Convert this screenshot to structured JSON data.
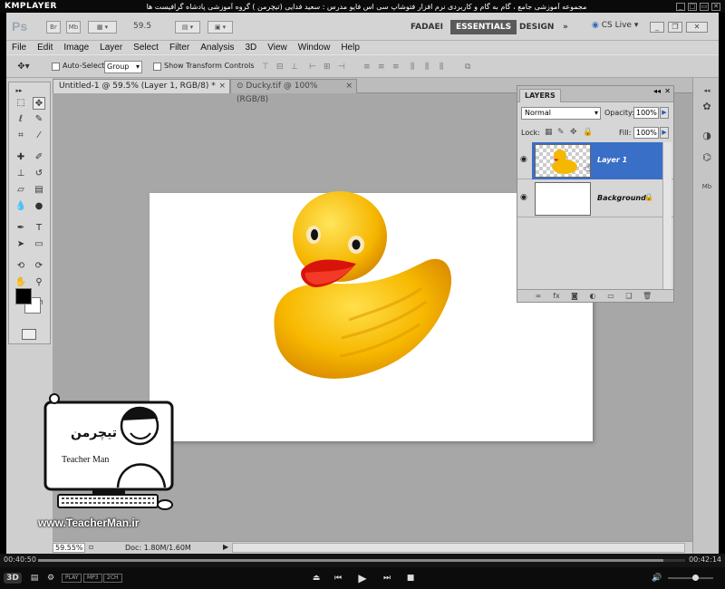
{
  "player": {
    "logo": "KMPLAYER",
    "title": "مجموعه آموزشی جامع ، گام به گام و کاربردی نرم افزار فتوشاپ سی اس فایو  مدرس : سعید فدایی (تیچرمن ) گروه آموزشی پادشاه گرافیست ها",
    "time_elapsed": "00:40:50",
    "time_total": "00:42:14",
    "progress": 0.967,
    "badges": [
      "PLAY",
      "MP3",
      "2CH"
    ],
    "mode_label": "3D",
    "volume": 0.6,
    "window_buttons": [
      "_",
      "□",
      "▭",
      "✕"
    ]
  },
  "ps": {
    "logo": "Ps",
    "appbar": {
      "br_label": "Br",
      "mb_label": "Mb",
      "zoom": "59.5",
      "workspaces": [
        "FADAEI",
        "ESSENTIALS",
        "DESIGN"
      ],
      "active_workspace": "ESSENTIALS",
      "more": "»",
      "cslive": "CS Live"
    },
    "menu": [
      "File",
      "Edit",
      "Image",
      "Layer",
      "Select",
      "Filter",
      "Analysis",
      "3D",
      "View",
      "Window",
      "Help"
    ],
    "options": {
      "auto_select_label": "Auto-Select:",
      "auto_select_value": "Group",
      "show_transform_label": "Show Transform Controls"
    },
    "tabs": [
      {
        "label": "Untitled-1 @ 59.5% (Layer 1, RGB/8) *",
        "close": "×"
      },
      {
        "label": "Ducky.tif @ 100% (RGB/8)",
        "close": "×"
      }
    ],
    "status": {
      "zoom": "59.55%",
      "doc": "Doc: 1.80M/1.60M"
    },
    "layers_panel": {
      "title": "LAYERS",
      "blend_mode": "Normal",
      "opacity_label": "Opacity:",
      "opacity": "100%",
      "lock_label": "Lock:",
      "fill_label": "Fill:",
      "fill": "100%",
      "layers": [
        {
          "name": "Layer 1",
          "selected": true
        },
        {
          "name": "Background",
          "selected": false
        }
      ]
    },
    "colors": {
      "accent": "#3a6fc8",
      "duck": "#f5b800"
    }
  },
  "watermark": {
    "brand": "Teacher Man",
    "brand_fa": "تیچرمن",
    "site": "www.TeacherMan.ir"
  }
}
